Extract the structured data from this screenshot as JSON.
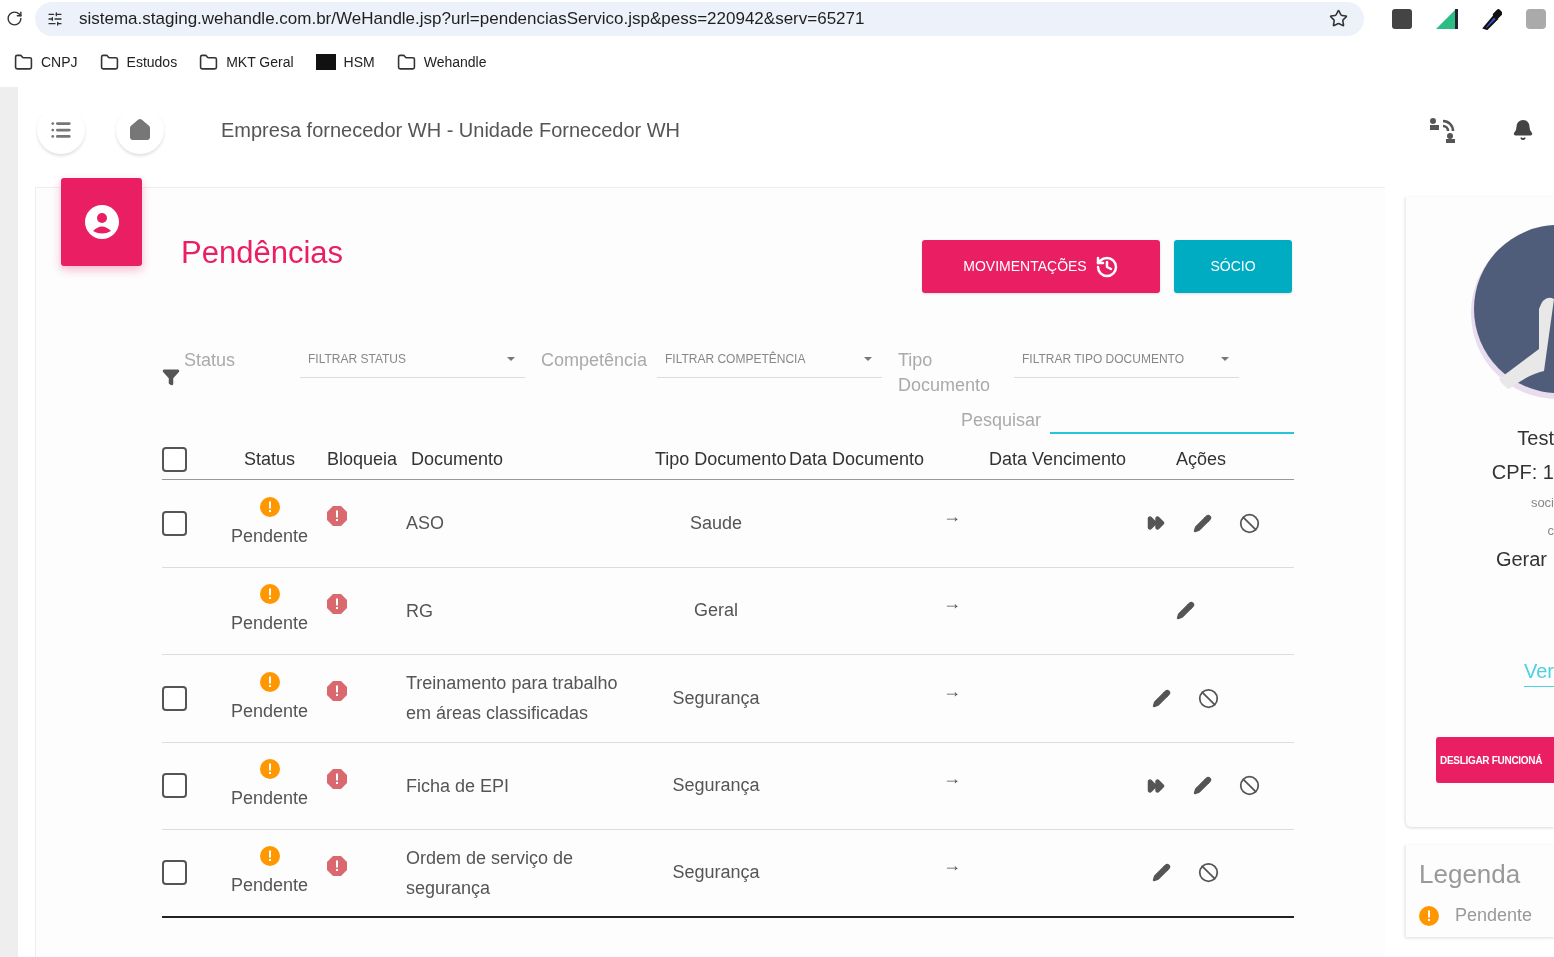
{
  "browser": {
    "url": "sistema.staging.wehandle.com.br/WeHandle.jsp?url=pendenciasServico.jsp&pess=220942&serv=65271",
    "bookmarks": [
      {
        "label": "CNPJ",
        "kind": "folder"
      },
      {
        "label": "Estudos",
        "kind": "folder"
      },
      {
        "label": "MKT Geral",
        "kind": "folder"
      },
      {
        "label": "HSM",
        "kind": "site"
      },
      {
        "label": "Wehandle",
        "kind": "folder"
      }
    ]
  },
  "header": {
    "title": "Empresa fornecedor WH - Unidade Fornecedor WH"
  },
  "page": {
    "title": "Pendências",
    "buttons": [
      {
        "label": "MOVIMENTAÇÕES",
        "kind": "history"
      },
      {
        "label": "SÓCIO",
        "kind": "plain"
      }
    ]
  },
  "filters": [
    {
      "label": "Status",
      "placeholder": "FILTRAR STATUS"
    },
    {
      "label": "Competência",
      "placeholder": "FILTRAR COMPETÊNCIA"
    },
    {
      "label": "Tipo Documento",
      "placeholder": "FILTRAR TIPO DOCUMENTO"
    }
  ],
  "search": {
    "label": "Pesquisar"
  },
  "table": {
    "select_all": {
      "checked": false
    },
    "columns": [
      "Status",
      "Bloqueia",
      "Documento",
      "Tipo Documento",
      "Data Documento",
      "Data Vencimento",
      "Ações"
    ],
    "rows": [
      {
        "checked": false,
        "status": "Pendente",
        "document": "ASO",
        "type": "Saude",
        "date": "→",
        "actions": [
          {
            "kind": "forward"
          },
          {
            "kind": "edit"
          },
          {
            "kind": "block"
          }
        ]
      },
      {
        "status": "Pendente",
        "document": "RG",
        "type": "Geral",
        "date": "→",
        "actions": [
          {
            "kind": "edit"
          }
        ]
      },
      {
        "checked": false,
        "status": "Pendente",
        "document": "Treinamento para trabalho em áreas classificadas",
        "type": "Segurança",
        "date": "→",
        "actions": [
          {
            "kind": "edit"
          },
          {
            "kind": "block"
          }
        ]
      },
      {
        "checked": false,
        "status": "Pendente",
        "document": "Ficha de EPI",
        "type": "Segurança",
        "date": "→",
        "actions": [
          {
            "kind": "forward"
          },
          {
            "kind": "edit"
          },
          {
            "kind": "block"
          }
        ]
      },
      {
        "checked": false,
        "status": "Pendente",
        "document": "Ordem de serviço de segurança",
        "type": "Segurança",
        "date": "→",
        "actions": [
          {
            "kind": "edit"
          },
          {
            "kind": "block"
          }
        ]
      }
    ]
  },
  "profile": {
    "name": "Test",
    "cpf": "CPF: 1",
    "line_1": "soci",
    "line_2": "c",
    "generate": "Gerar",
    "view": "Ver",
    "button": "DESLIGAR FUNCIONÁ"
  },
  "legend": {
    "title": "Legenda",
    "items": [
      {
        "label": "Pendente",
        "kind": "pending"
      }
    ]
  }
}
